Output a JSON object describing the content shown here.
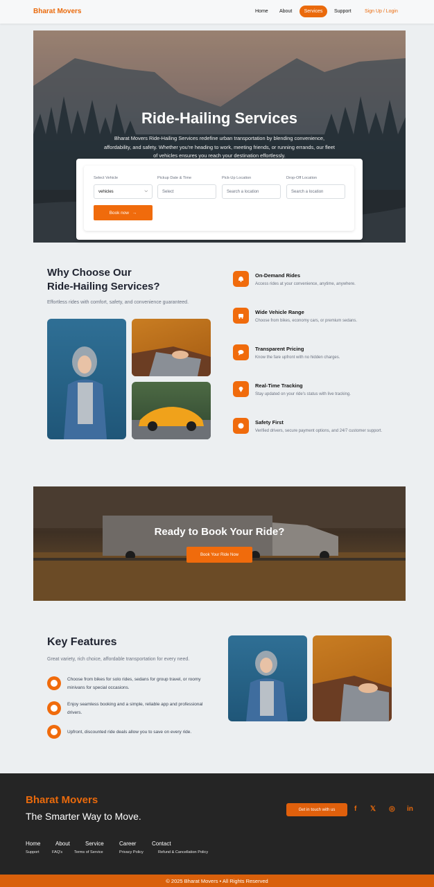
{
  "nav": {
    "brand": "Bharat Movers",
    "links": [
      "Home",
      "About",
      "Services",
      "Support"
    ],
    "login": "Sign Up / Login"
  },
  "hero": {
    "title": "Ride-Hailing Services",
    "description": "Bharat Movers Ride-Hailing Services redefine urban transportation by blending convenience, affordability, and safety. Whether you're heading to work, meeting friends, or running errands, our fleet of vehicles ensures you reach your destination effortlessly."
  },
  "booking": {
    "vehicle_label": "Select Vehicle",
    "vehicle_value": "vehicles",
    "date_label": "Pickup Date & Time",
    "date_placeholder": "Select",
    "pickup_label": "Pick-Up Location",
    "pickup_placeholder": "Search a location",
    "dropoff_label": "Drop-Off Location",
    "dropoff_placeholder": "Search a location",
    "book_label": "Book now",
    "book_arrow": "→"
  },
  "why": {
    "title_line1": "Why Choose Our",
    "title_line2": "Ride-Hailing Services?",
    "subtitle": "Effortless rides with comfort, safety, and convenience guaranteed.",
    "features": [
      {
        "title": "On-Demand Rides",
        "desc": "Access rides at your convenience, anytime, anywhere.",
        "icon": "bell-icon"
      },
      {
        "title": "Wide Vehicle Range",
        "desc": "Choose from bikes, economy cars, or premium sedans.",
        "icon": "vehicle-icon"
      },
      {
        "title": "Transparent Pricing",
        "desc": "Know the fare upfront with no hidden charges.",
        "icon": "chat-icon"
      },
      {
        "title": "Real-Time Tracking",
        "desc": "Stay updated on your ride's status with live tracking.",
        "icon": "location-pin-icon"
      },
      {
        "title": "Safety First",
        "desc": "Verified drivers, secure payment options, and 24/7 customer support.",
        "icon": "shield-icon"
      }
    ]
  },
  "cta": {
    "title": "Ready to Book Your Ride?",
    "button": "Book Your Ride Now"
  },
  "key_features": {
    "title": "Key Features",
    "subtitle": "Great variety, rich choice, affordable transportation for every need.",
    "items": [
      "Choose from bikes for solo rides, sedans for group travel, or roomy minivans for special occasions.",
      "Enjoy seamless booking and a simple, reliable app and professional drivers.",
      "Upfront, discounted ride deals allow you to save on every ride."
    ]
  },
  "footer": {
    "brand": "Bharat Movers",
    "tagline": "The Smarter Way to Move.",
    "cta": "Get in touch with us",
    "social": [
      "f",
      "𝕏",
      "◎",
      "in"
    ],
    "links": [
      "Home",
      "About",
      "Service",
      "Career",
      "Contact"
    ],
    "sublinks": [
      "Support",
      "FAQ's",
      "Terms of Service",
      "Privacy Policy",
      "Refund & Cancellation Policy"
    ],
    "copyright": "© 2025 Bharat Movers • All Rights Reserved"
  },
  "colors": {
    "accent": "#f06b0c",
    "footer_bg": "#252525"
  }
}
